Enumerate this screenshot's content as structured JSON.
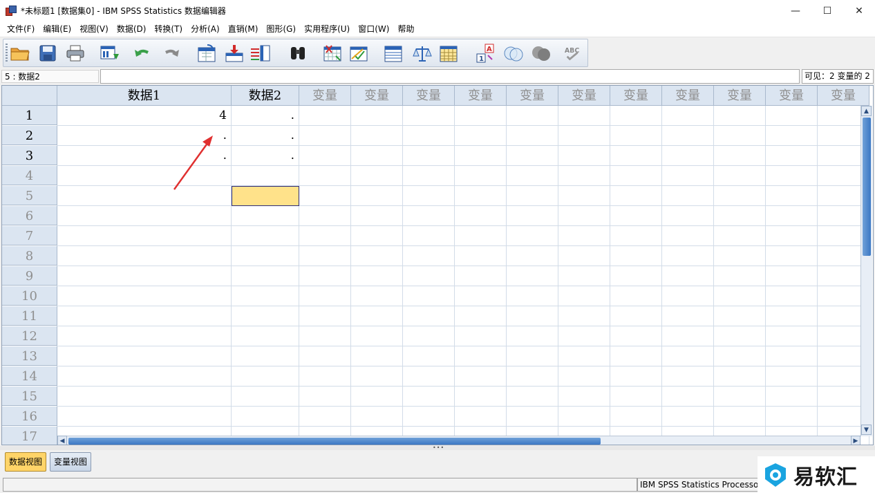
{
  "window": {
    "title": "*未标题1 [数据集0] - IBM SPSS Statistics 数据编辑器",
    "minimize": "—",
    "maximize": "☐",
    "close": "✕"
  },
  "menu": [
    "文件(F)",
    "编辑(E)",
    "视图(V)",
    "数据(D)",
    "转换(T)",
    "分析(A)",
    "直销(M)",
    "图形(G)",
    "实用程序(U)",
    "窗口(W)",
    "帮助"
  ],
  "toolbar_icons": [
    "open-folder-icon",
    "save-icon",
    "print-icon",
    "dialog-recall-icon",
    "undo-icon",
    "redo-icon",
    "go-to-case-icon",
    "insert-case-icon",
    "insert-variable-icon",
    "find-icon",
    "split-file-icon",
    "select-cases-icon",
    "data-grid-icon",
    "weight-cases-icon",
    "value-table-icon",
    "value-labels-icon",
    "use-sets-icon",
    "show-all-variables-icon",
    "spell-check-icon"
  ],
  "cellbar": {
    "reference": "5 : 数据2",
    "visible": "可见：2 变量的 2"
  },
  "grid": {
    "columns": [
      "数据1",
      "数据2",
      "变量",
      "变量",
      "变量",
      "变量",
      "变量",
      "变量",
      "变量",
      "变量",
      "变量",
      "变量",
      "变量"
    ],
    "rows": [
      "1",
      "2",
      "3",
      "4",
      "5",
      "6",
      "7",
      "8",
      "9",
      "10",
      "11",
      "12",
      "13",
      "14",
      "15",
      "16",
      "17"
    ],
    "used_rows": 3,
    "values": [
      [
        "4",
        "."
      ],
      [
        ".",
        "."
      ],
      [
        ".",
        "."
      ]
    ],
    "active_cell": {
      "row": 5,
      "column": 2
    },
    "active_color": "#ffe28a"
  },
  "tabs": {
    "data_view": "数据视图",
    "variable_view": "变量视图"
  },
  "status": {
    "processor": "IBM SPSS Statistics Processor"
  },
  "watermark": {
    "text": "易软汇"
  },
  "colors": {
    "header_bg": "#dbe5f1",
    "arrow": "#e03030",
    "tab_active": "#ffd468"
  }
}
